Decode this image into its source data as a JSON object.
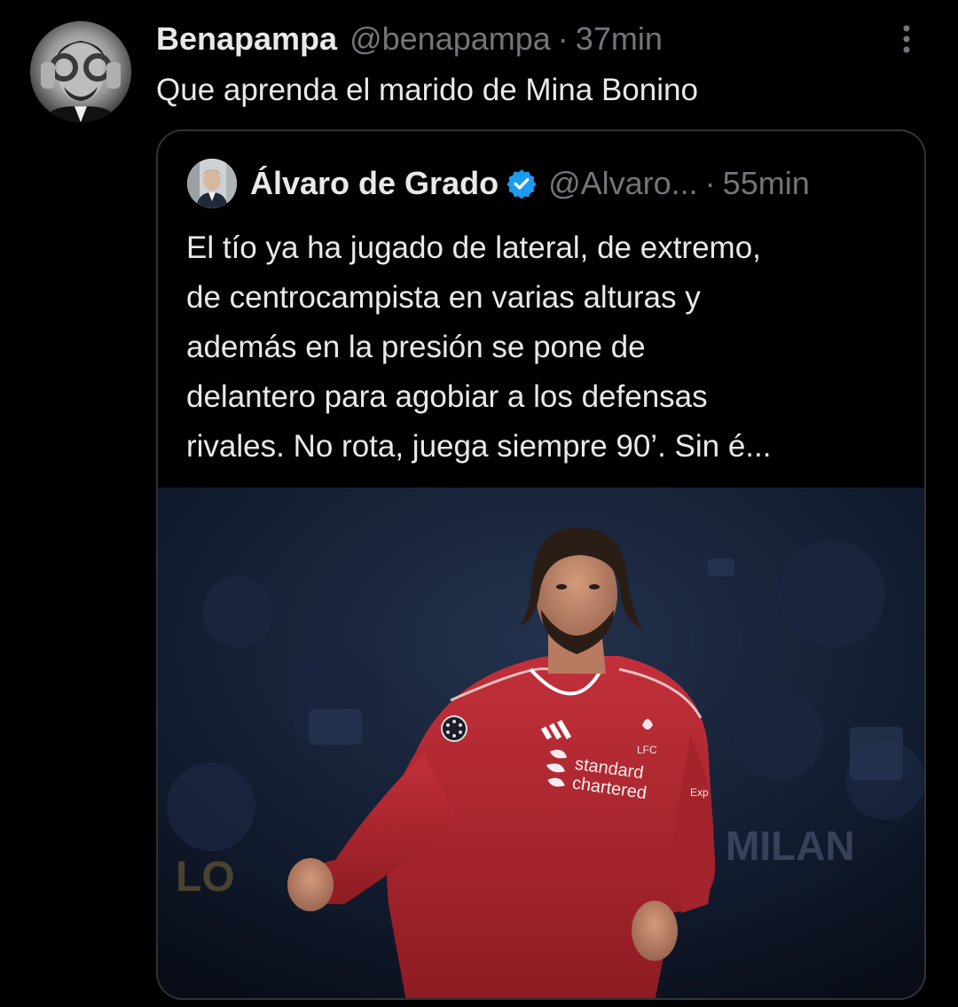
{
  "tweet": {
    "author_name": "Benapampa",
    "author_handle": "@benapampa",
    "separator": "·",
    "time": "37min",
    "text": "Que aprenda el marido de Mina Bonino",
    "more_icon": "three-dots-vertical-icon"
  },
  "quote": {
    "author_name": "Álvaro de Grado",
    "author_handle": "@Alvaro...",
    "separator": "·",
    "time": "55min",
    "verified_icon": "verified-badge-icon",
    "verified_color": "#1d9bf0",
    "text_lines": [
      "El tío ya ha jugado de lateral, de extremo,",
      "de centrocampista en varias alturas y",
      "además en la presión se pone de",
      "delantero para agobiar a los defensas",
      "rivales. No rota, juega siempre 90’. Sin é..."
    ],
    "media": {
      "sponsor_line1": "standard",
      "sponsor_line2": "chartered",
      "crest_text": "LFC",
      "sleeve_text": "Exp",
      "banner_left": "LO",
      "banner_right": "MILAN"
    }
  },
  "colors": {
    "background": "#000000",
    "text_primary": "#e7e9ea",
    "text_secondary": "#71767b",
    "border": "#2f3336",
    "shirt_red": "#b3262e"
  }
}
